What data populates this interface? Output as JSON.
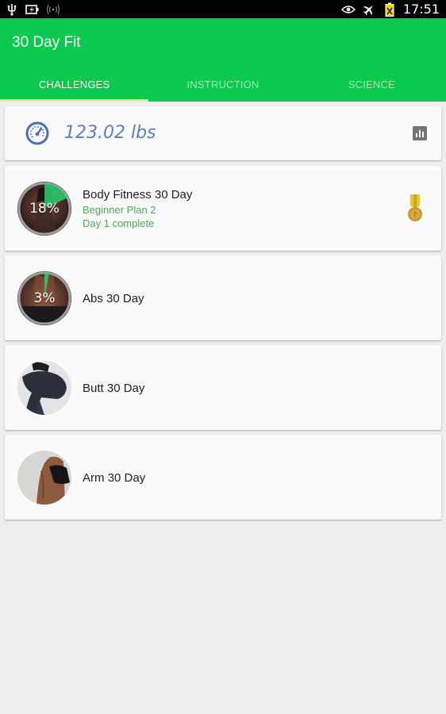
{
  "status_bar": {
    "time": "17:51"
  },
  "app": {
    "title": "30 Day Fit"
  },
  "tabs": [
    {
      "label": "CHALLENGES",
      "active": true
    },
    {
      "label": "INSTRUCTION",
      "active": false
    },
    {
      "label": "SCIENCE",
      "active": false
    }
  ],
  "weight": {
    "value": "123.02 lbs"
  },
  "challenges": [
    {
      "title": "Body Fitness 30 Day",
      "plan": "Beginner Plan 2",
      "status": "Day 1 complete",
      "progress": "18%",
      "progress_value": 0.18,
      "medal": true
    },
    {
      "title": "Abs 30 Day",
      "progress": "3%",
      "progress_value": 0.03
    },
    {
      "title": "Butt 30 Day"
    },
    {
      "title": "Arm 30 Day"
    }
  ],
  "colors": {
    "primary": "#0ac94f",
    "tab_indicator": "#e8f28a",
    "progress_green": "#2ecc71",
    "subtitle_green": "#4caf50",
    "weight_text": "#5b7fc2",
    "medal_ribbon": "#e4c72a",
    "medal_coin": "#c9962f"
  },
  "icons": {
    "status_left": [
      "usb-icon",
      "battery-charging-icon",
      "wifi-icon"
    ],
    "status_right": [
      "eye-icon",
      "airplane-icon",
      "battery-icon"
    ],
    "weight": "speedometer-icon",
    "chart": "bar-chart-icon",
    "medal": "medal-icon"
  }
}
